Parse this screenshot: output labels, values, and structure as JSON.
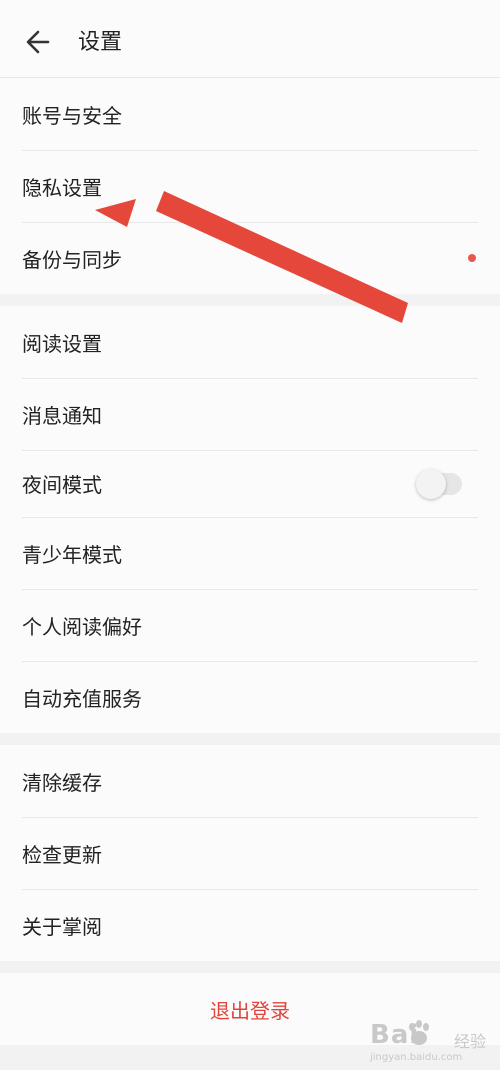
{
  "header": {
    "title": "设置",
    "back_icon": "arrow-left-icon"
  },
  "groups": [
    {
      "items": [
        {
          "label": "账号与安全"
        },
        {
          "label": "隐私设置"
        },
        {
          "label": "备份与同步",
          "badge": "red-dot"
        }
      ]
    },
    {
      "items": [
        {
          "label": "阅读设置"
        },
        {
          "label": "消息通知"
        },
        {
          "label": "夜间模式",
          "toggle": "off"
        },
        {
          "label": "青少年模式"
        },
        {
          "label": "个人阅读偏好"
        },
        {
          "label": "自动充值服务"
        }
      ]
    },
    {
      "items": [
        {
          "label": "清除缓存"
        },
        {
          "label": "检查更新"
        },
        {
          "label": "关于掌阅"
        }
      ]
    }
  ],
  "logout": {
    "label": "退出登录"
  },
  "colors": {
    "accent": "#e0453c",
    "annotation_arrow": "#e5473b",
    "background": "#f2f2f2",
    "surface": "#fbfbfb"
  },
  "watermark": {
    "logo": "Bai",
    "paw_icon": "baidu-paw-icon",
    "cn": "经验",
    "sub": "jingyan.baidu.com"
  }
}
